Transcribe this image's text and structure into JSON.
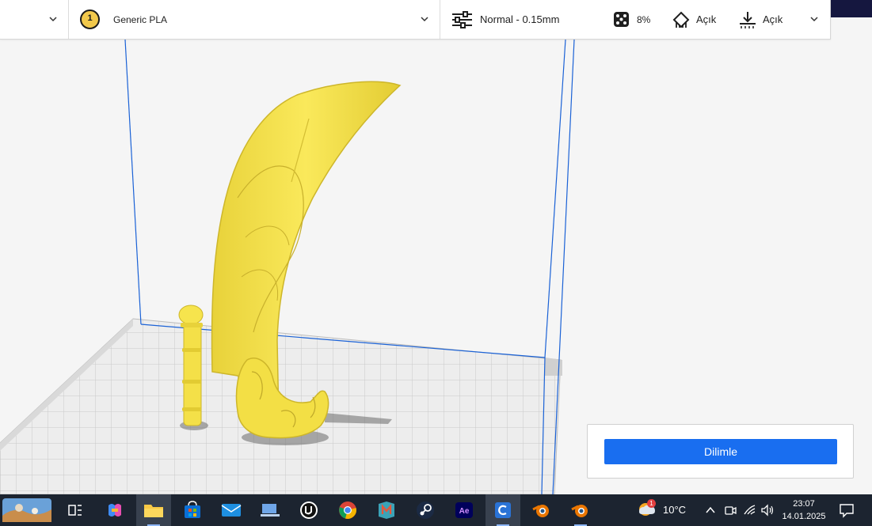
{
  "toolbar": {
    "material": {
      "extruder_number": "1",
      "label": "Generic PLA"
    },
    "profile": {
      "label": "Normal - 0.15mm"
    },
    "settings": {
      "infill": "8%",
      "support": "Açık",
      "adhesion": "Açık"
    }
  },
  "slice_panel": {
    "button_label": "Dilimle",
    "button_color": "#196ef0"
  },
  "taskbar": {
    "apps": [
      "start-widget",
      "task-view",
      "copilot",
      "file-explorer",
      "microsoft-store",
      "mail",
      "vscode",
      "unreal-engine",
      "chrome",
      "maya",
      "steam",
      "after-effects",
      "cura",
      "blender",
      "blender"
    ],
    "weather": {
      "temperature": "10°C",
      "badge": "1"
    },
    "clock": {
      "time": "23:07",
      "date": "14.01.2025"
    }
  },
  "colors": {
    "model": "#f5e24a",
    "build_volume": "#1b62d6",
    "taskbar": "#1c2430"
  }
}
